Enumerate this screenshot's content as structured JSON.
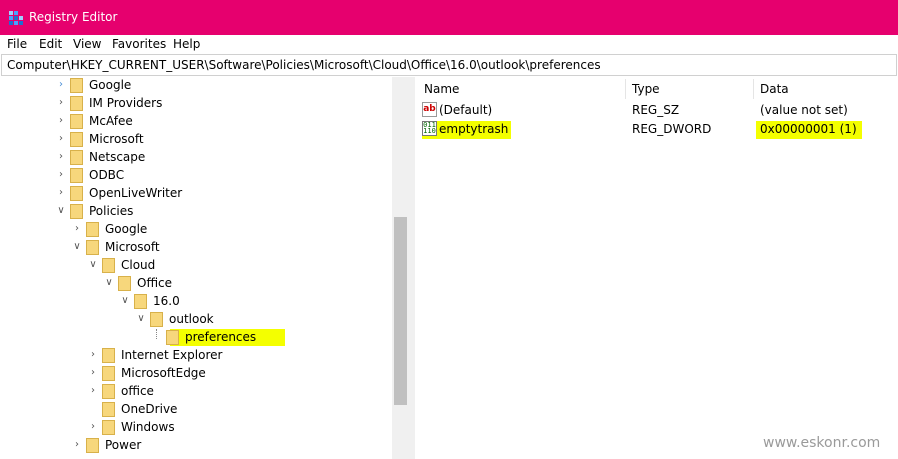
{
  "window": {
    "title": "Registry Editor",
    "titlebar_color": "#e6006e",
    "app_icon": "registry-editor-icon"
  },
  "menu": [
    "File",
    "Edit",
    "View",
    "Favorites",
    "Help"
  ],
  "address": "Computer\\HKEY_CURRENT_USER\\Software\\Policies\\Microsoft\\Cloud\\Office\\16.0\\outlook\\preferences",
  "tree": [
    {
      "label": "Google",
      "state": "collapsed"
    },
    {
      "label": "IM Providers",
      "state": "collapsed"
    },
    {
      "label": "McAfee",
      "state": "collapsed"
    },
    {
      "label": "Microsoft",
      "state": "collapsed"
    },
    {
      "label": "Netscape",
      "state": "collapsed"
    },
    {
      "label": "ODBC",
      "state": "collapsed"
    },
    {
      "label": "OpenLiveWriter",
      "state": "collapsed"
    },
    {
      "label": "Policies",
      "state": "expanded"
    },
    {
      "label": "Google",
      "state": "collapsed"
    },
    {
      "label": "Microsoft",
      "state": "expanded"
    },
    {
      "label": "Cloud",
      "state": "expanded"
    },
    {
      "label": "Office",
      "state": "expanded"
    },
    {
      "label": "16.0",
      "state": "expanded"
    },
    {
      "label": "outlook",
      "state": "expanded"
    },
    {
      "label": "preferences",
      "state": "selected"
    },
    {
      "label": "Internet Explorer",
      "state": "collapsed"
    },
    {
      "label": "MicrosoftEdge",
      "state": "collapsed"
    },
    {
      "label": "office",
      "state": "collapsed"
    },
    {
      "label": "OneDrive",
      "state": "leaf"
    },
    {
      "label": "Windows",
      "state": "collapsed"
    },
    {
      "label": "Power",
      "state": "collapsed"
    }
  ],
  "columns": {
    "name": "Name",
    "type": "Type",
    "data": "Data"
  },
  "values": [
    {
      "name": "(Default)",
      "type": "REG_SZ",
      "data": "(value not set)",
      "icon": "string-value-icon",
      "icon_text": "ab"
    },
    {
      "name": "emptytrash",
      "type": "REG_DWORD",
      "data": "0x00000001 (1)",
      "icon": "binary-value-icon",
      "icon_text": "011 110"
    }
  ],
  "highlight_color": "#f4ff00",
  "watermark": "www.eskonr.com"
}
